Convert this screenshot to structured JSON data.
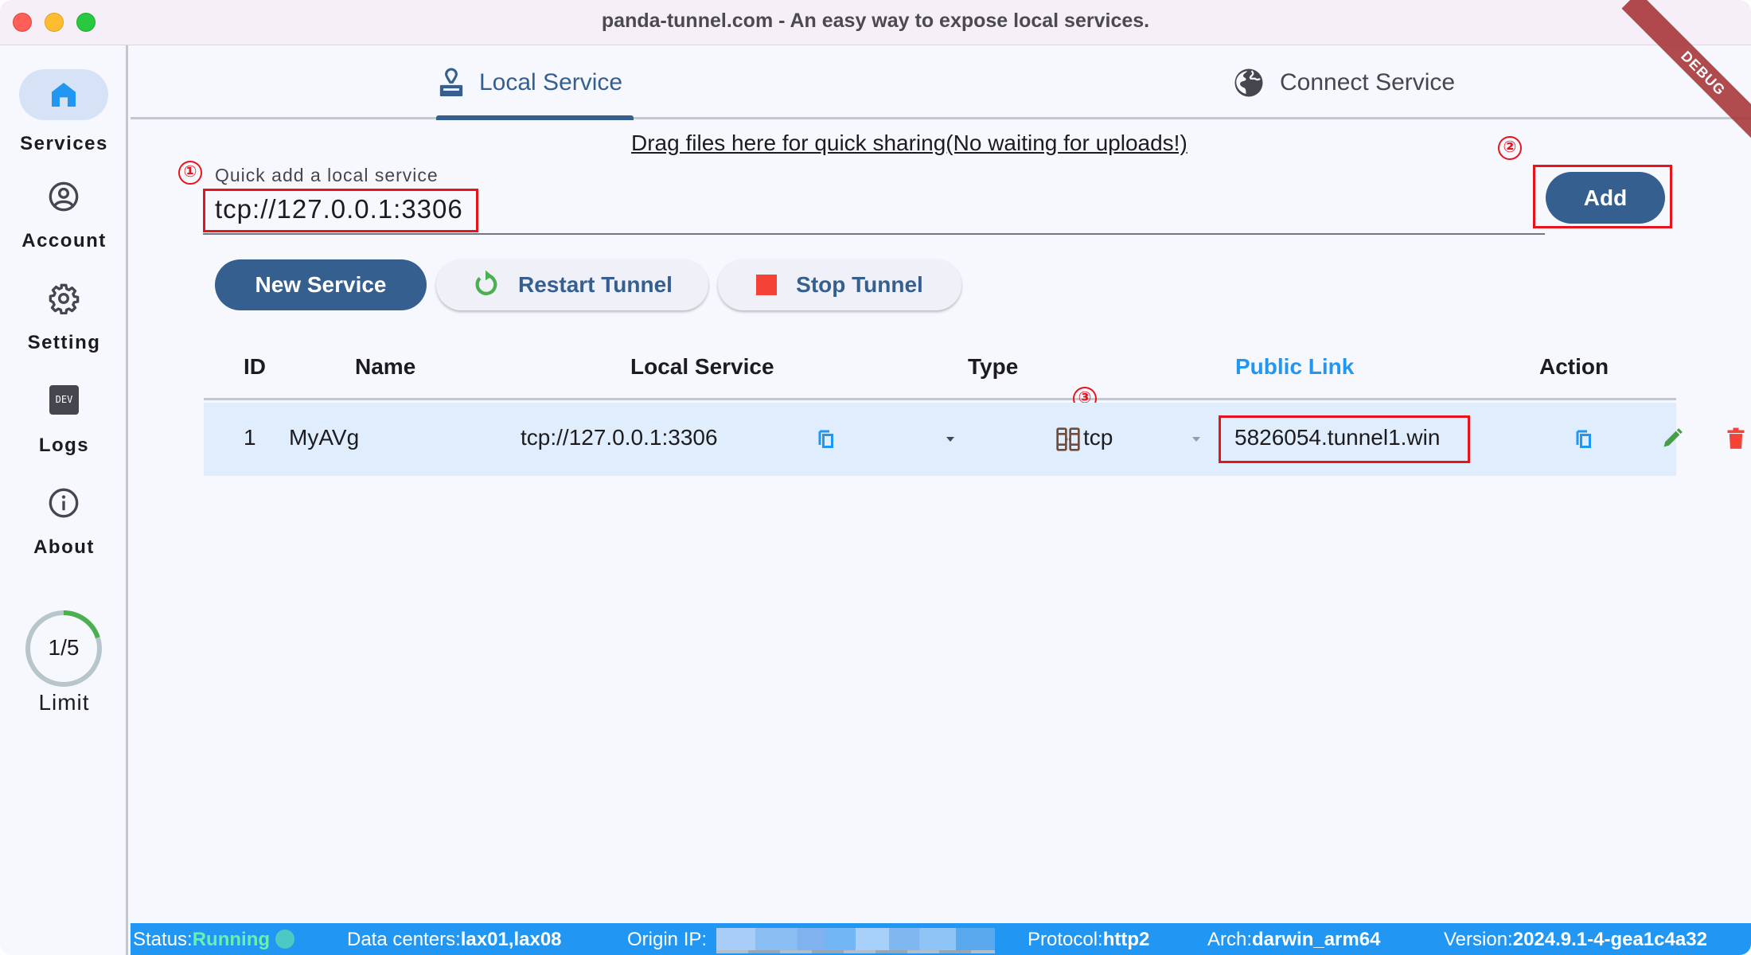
{
  "window": {
    "title": "panda-tunnel.com - An easy way to expose local services.",
    "debug_banner": "DEBUG"
  },
  "sidebar": {
    "items": [
      {
        "label": "Services",
        "icon": "home-icon",
        "active": true
      },
      {
        "label": "Account",
        "icon": "account-circle-icon",
        "active": false
      },
      {
        "label": "Setting",
        "icon": "gear-icon",
        "active": false
      },
      {
        "label": "Logs",
        "icon": "dev-logs-icon",
        "icon_text": "DEV",
        "active": false
      },
      {
        "label": "About",
        "icon": "info-icon",
        "active": false
      }
    ],
    "limit": {
      "text": "1/5",
      "label": "Limit",
      "used": 1,
      "total": 5
    }
  },
  "tabs": [
    {
      "label": "Local Service",
      "icon": "stamp-icon",
      "active": true
    },
    {
      "label": "Connect Service",
      "icon": "globe-icon",
      "active": false
    }
  ],
  "drag_hint": "Drag files here for quick sharing(No waiting for uploads!)",
  "quick_add": {
    "label": "Quick add a local service",
    "value": "tcp://127.0.0.1:3306",
    "add_label": "Add"
  },
  "annotations": [
    "①",
    "②",
    "③"
  ],
  "actions": {
    "new_service": "New Service",
    "restart_tunnel": "Restart Tunnel",
    "stop_tunnel": "Stop Tunnel"
  },
  "table": {
    "headers": [
      "ID",
      "Name",
      "Local Service",
      "Type",
      "Public Link",
      "Action"
    ],
    "rows": [
      {
        "id": "1",
        "name": "MyAVg",
        "local_service": "tcp://127.0.0.1:3306",
        "type": "tcp",
        "public_link": "5826054.tunnel1.win"
      }
    ]
  },
  "statusbar": {
    "status_label": "Status:",
    "status_value": "Running",
    "datacenters_label": "Data centers:",
    "datacenters_value": "lax01,lax08",
    "origin_ip_label": "Origin IP:",
    "protocol_label": "Protocol:",
    "protocol_value": "http2",
    "arch_label": "Arch:",
    "arch_value": "darwin_arm64",
    "version_label": "Version:",
    "version_value": "2024.9.1-4-gea1c4a32"
  },
  "colors": {
    "primary": "#345f8f",
    "statusbar": "#2196f3",
    "running": "#69f0ae",
    "annotation_red": "#e8141c",
    "delete": "#f44336",
    "edit": "#43a047",
    "limit_progress": "#4caf50"
  }
}
